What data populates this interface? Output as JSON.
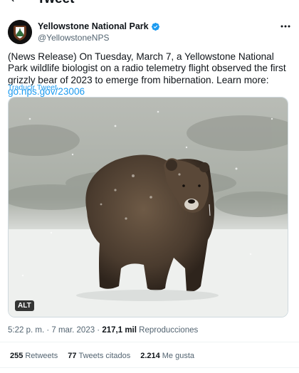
{
  "header": {
    "title": "Tweet",
    "back_icon": "arrow-left-icon"
  },
  "author": {
    "name": "Yellowstone National Park",
    "handle": "@YellowstoneNPS",
    "verified_icon": "verified-badge-icon",
    "more_icon": "more-horizontal-icon"
  },
  "tweet": {
    "text": "(News Release) On Tuesday, March 7, a Yellowstone National Park wildlife biologist on a radio telemetry flight observed the first grizzly bear of 2023 to emerge from hibernation. Learn more: ",
    "link": "go.nps.gov/23006",
    "translate_label": "Traducir Tweet"
  },
  "media": {
    "alt_label": "ALT"
  },
  "meta": {
    "time": "5:22 p. m.",
    "separator": " · ",
    "date": "7 mar. 2023",
    "views_count": "217,1 mil",
    "views_label": "Reproducciones"
  },
  "stats": [
    {
      "count": "255",
      "label": "Retweets"
    },
    {
      "count": "77",
      "label": "Tweets citados"
    },
    {
      "count": "2.214",
      "label": "Me gusta"
    }
  ],
  "colors": {
    "accent": "#1d9bf0",
    "secondary_text": "#536471",
    "primary_text": "#0f1419"
  }
}
